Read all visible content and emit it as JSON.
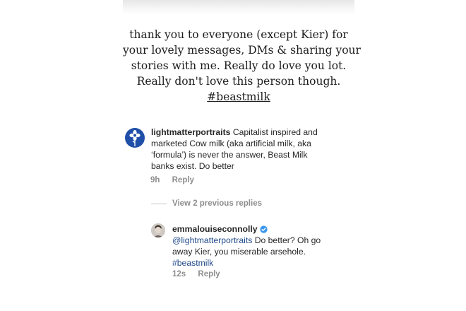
{
  "caption": {
    "lines": [
      "thank you to everyone (except Kier) for",
      "your lovely messages, DMs & sharing your",
      "stories with me. Really do love you lot.",
      "Really don't love this person though."
    ],
    "hashtag": "#beastmilk"
  },
  "comments": [
    {
      "username": "lightmatterportraits",
      "text": "Capitalist inspired and marketed Cow milk (aka artificial milk, aka ‘formula’) is never the answer, Beast Milk banks exist. Do better",
      "time": "9h",
      "reply_label": "Reply",
      "avatar_icon": "flower-icon"
    }
  ],
  "view_replies_label": "View 2 previous replies",
  "reply": {
    "username": "emmalouiseconnolly",
    "verified_icon": "verified-badge-icon",
    "mention": "@lightmatterportraits",
    "text": "Do better? Oh go away Kier, you miserable arsehole.",
    "hashtag": "#beastmilk",
    "time": "12s",
    "reply_label": "Reply"
  },
  "colors": {
    "avatar_bg": "#1f4fa8",
    "link": "#1f4a8a",
    "verified": "#3897f0",
    "meta": "#8e8e8e"
  }
}
